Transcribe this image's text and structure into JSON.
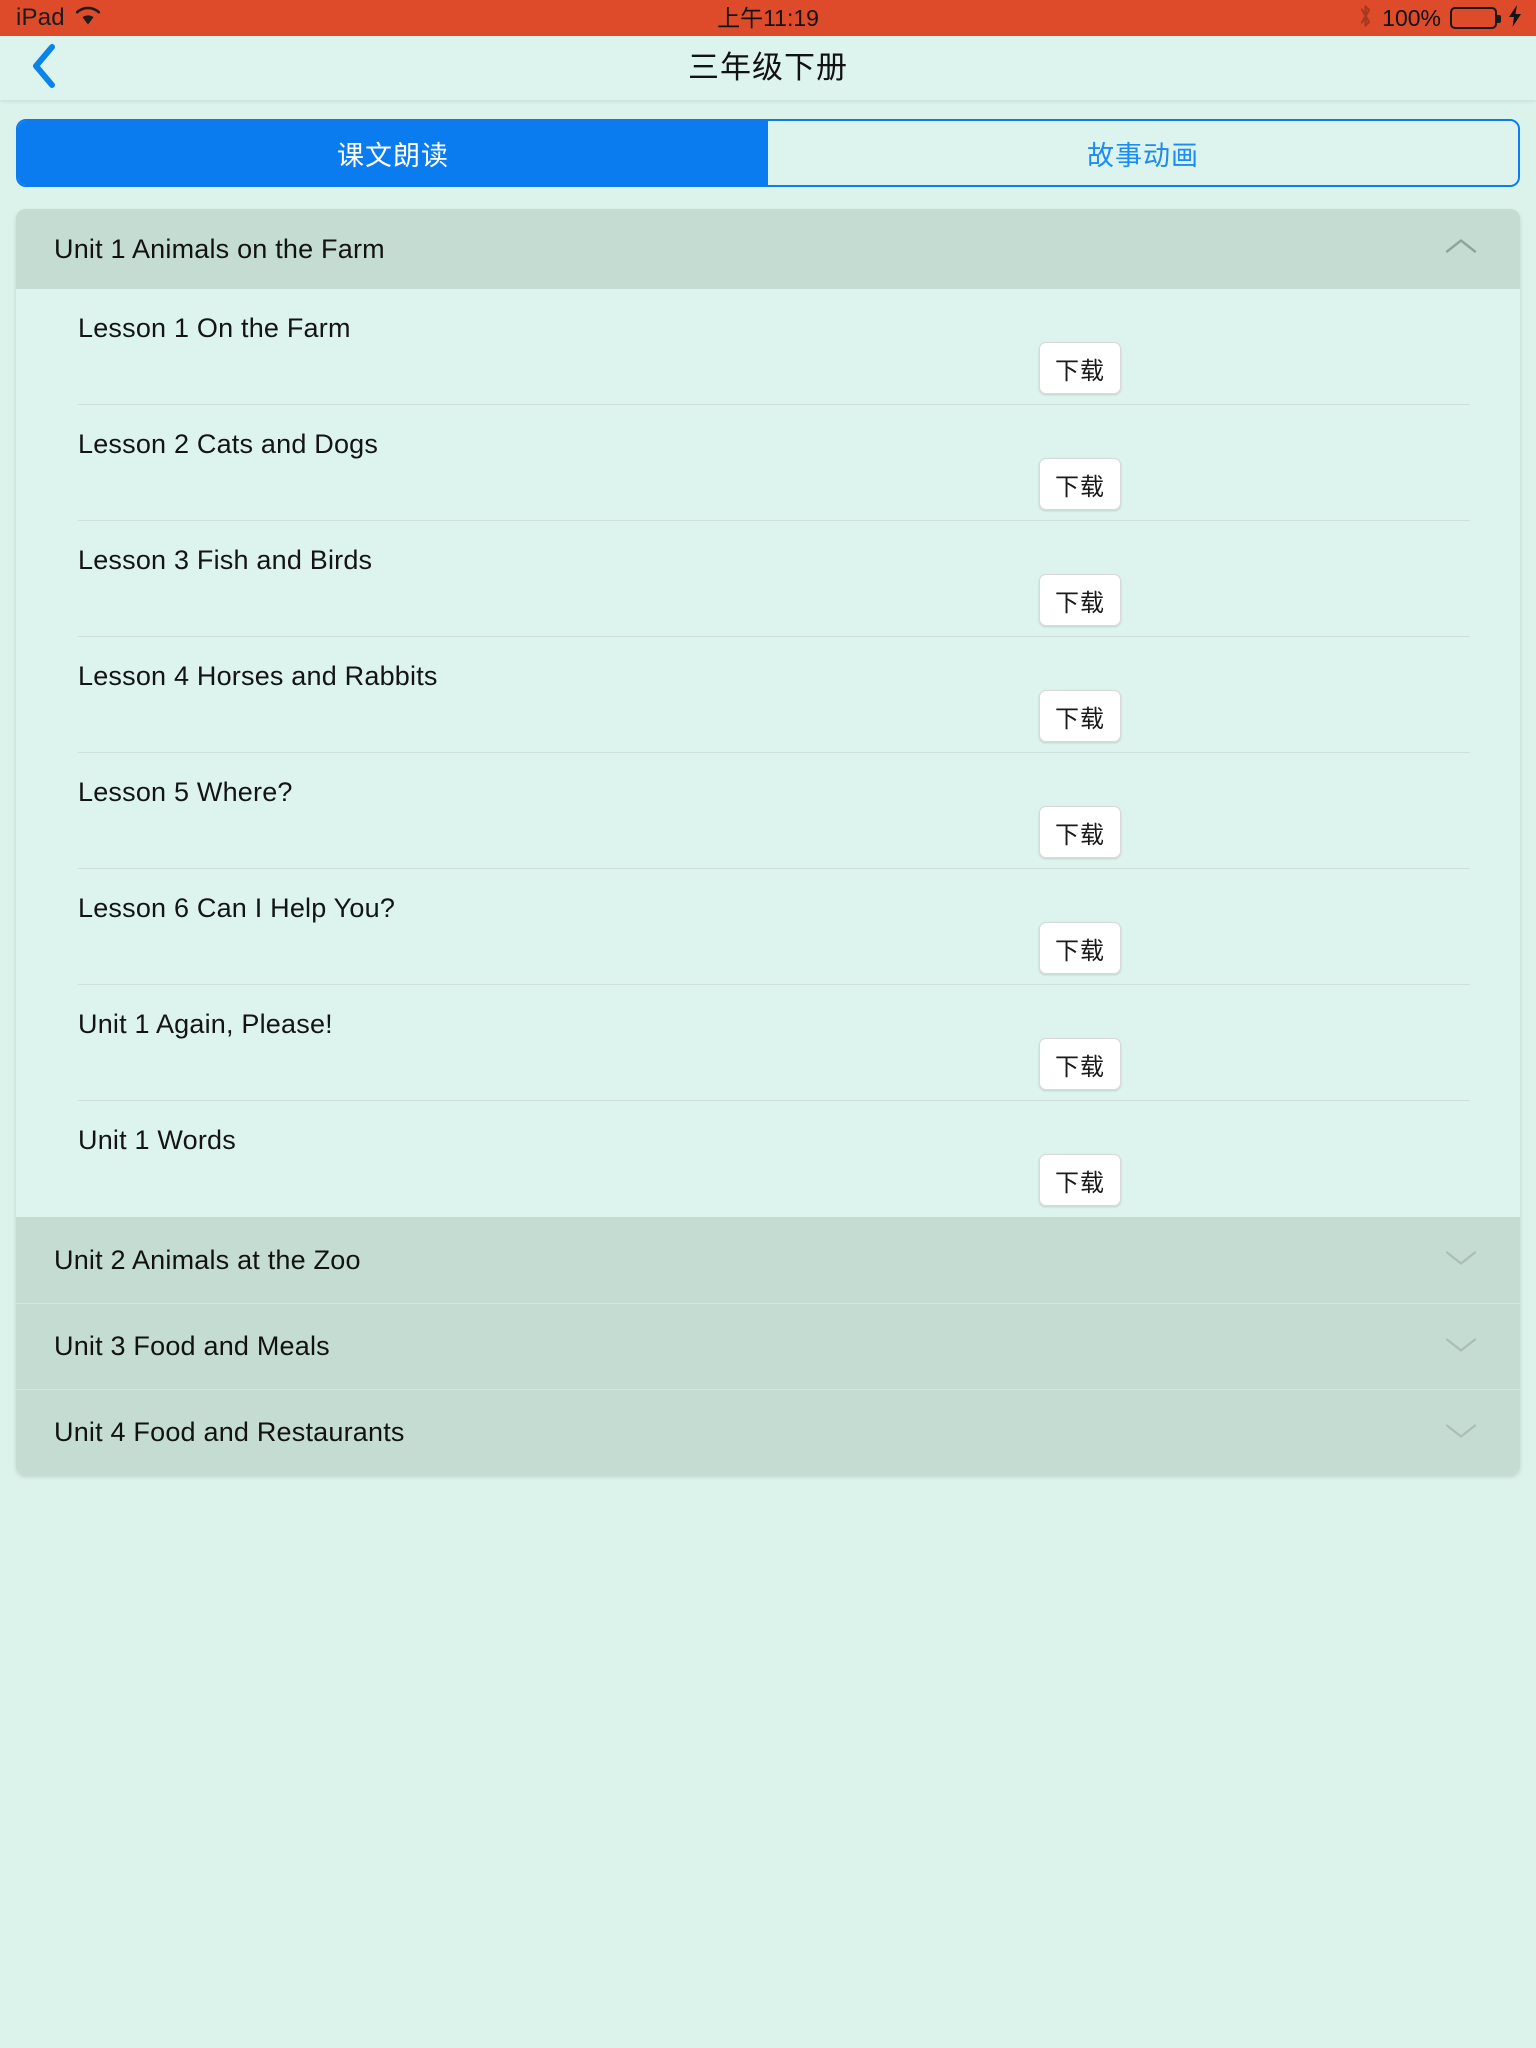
{
  "status_bar": {
    "device": "iPad",
    "wifi_icon": "wifi-icon",
    "time": "上午11:19",
    "bluetooth_icon": "bluetooth-icon",
    "battery_percent": "100%",
    "battery_icon": "battery-full-icon",
    "charging_icon": "lightning-bolt-icon",
    "background_color": "#dd4b2b"
  },
  "nav_bar": {
    "back_icon": "chevron-left-icon",
    "title": "三年级下册"
  },
  "segmented_control": {
    "accent_color": "#0a7cf0",
    "tabs": [
      {
        "label": "课文朗读",
        "active": true
      },
      {
        "label": "故事动画",
        "active": false
      }
    ]
  },
  "units": [
    {
      "title": "Unit 1 Animals on the Farm",
      "expanded": true,
      "chevron_icon": "chevron-up-icon",
      "lessons": [
        {
          "title": "Lesson 1 On the Farm",
          "action_label": "下载"
        },
        {
          "title": "Lesson 2 Cats and Dogs",
          "action_label": "下载"
        },
        {
          "title": "Lesson 3 Fish and Birds",
          "action_label": "下载"
        },
        {
          "title": "Lesson 4 Horses and Rabbits",
          "action_label": "下载"
        },
        {
          "title": "Lesson 5 Where?",
          "action_label": "下载"
        },
        {
          "title": "Lesson 6 Can I Help You?",
          "action_label": "下载"
        },
        {
          "title": "Unit 1 Again, Please!",
          "action_label": "下载"
        },
        {
          "title": "Unit 1 Words",
          "action_label": "下载"
        }
      ]
    },
    {
      "title": "Unit 2 Animals at the Zoo",
      "expanded": false,
      "chevron_icon": "chevron-down-icon",
      "lessons": []
    },
    {
      "title": "Unit 3 Food and Meals",
      "expanded": false,
      "chevron_icon": "chevron-down-icon",
      "lessons": []
    },
    {
      "title": "Unit 4 Food and Restaurants",
      "expanded": false,
      "chevron_icon": "chevron-down-icon",
      "lessons": []
    }
  ]
}
